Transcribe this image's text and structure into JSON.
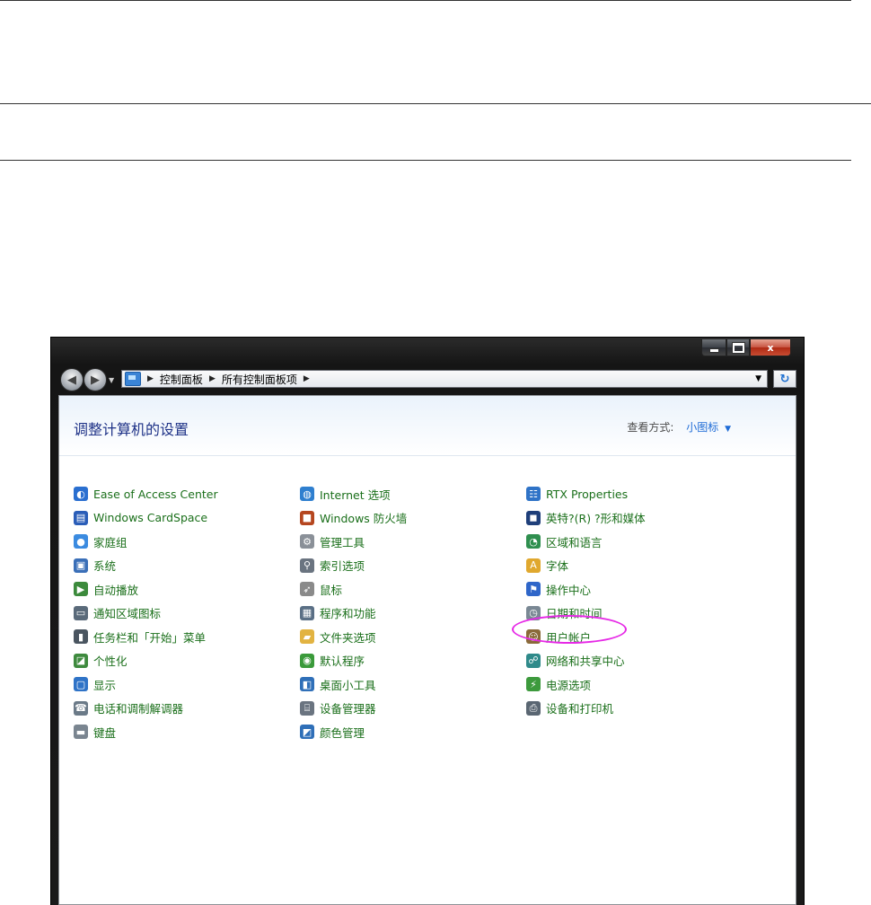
{
  "window": {
    "caption_buttons": {
      "minimize": "",
      "maximize": "",
      "close": "x"
    }
  },
  "address_bar": {
    "breadcrumbs": [
      "控制面板",
      "所有控制面板项"
    ]
  },
  "header": {
    "title": "调整计算机的设置",
    "view_by_label": "查看方式:",
    "view_by_value": "小图标"
  },
  "items": {
    "col1": [
      {
        "label": "Ease of Access Center",
        "icon": "ease-of-access-icon"
      },
      {
        "label": "Windows CardSpace",
        "icon": "cardspace-icon"
      },
      {
        "label": "家庭组",
        "icon": "homegroup-icon"
      },
      {
        "label": "系统",
        "icon": "system-icon"
      },
      {
        "label": "自动播放",
        "icon": "autoplay-icon"
      },
      {
        "label": "通知区域图标",
        "icon": "notification-icon"
      },
      {
        "label": "任务栏和「开始」菜单",
        "icon": "taskbar-icon"
      },
      {
        "label": "个性化",
        "icon": "personalization-icon"
      },
      {
        "label": "显示",
        "icon": "display-icon"
      },
      {
        "label": "电话和调制解调器",
        "icon": "phone-modem-icon"
      },
      {
        "label": "键盘",
        "icon": "keyboard-icon"
      }
    ],
    "col2": [
      {
        "label": "Internet 选项",
        "icon": "internet-options-icon"
      },
      {
        "label": "Windows 防火墙",
        "icon": "firewall-icon"
      },
      {
        "label": "管理工具",
        "icon": "admin-tools-icon"
      },
      {
        "label": "索引选项",
        "icon": "indexing-icon"
      },
      {
        "label": "鼠标",
        "icon": "mouse-icon"
      },
      {
        "label": "程序和功能",
        "icon": "programs-icon"
      },
      {
        "label": "文件夹选项",
        "icon": "folder-options-icon"
      },
      {
        "label": "默认程序",
        "icon": "default-programs-icon"
      },
      {
        "label": "桌面小工具",
        "icon": "gadgets-icon"
      },
      {
        "label": "设备管理器",
        "icon": "device-manager-icon"
      },
      {
        "label": "颜色管理",
        "icon": "color-management-icon"
      }
    ],
    "col3": [
      {
        "label": "RTX Properties",
        "icon": "rtx-icon"
      },
      {
        "label": "英特?(R) ?形和媒体",
        "icon": "intel-graphics-icon"
      },
      {
        "label": "区域和语言",
        "icon": "region-language-icon"
      },
      {
        "label": "字体",
        "icon": "fonts-icon"
      },
      {
        "label": "操作中心",
        "icon": "action-center-icon"
      },
      {
        "label": "日期和时间",
        "icon": "date-time-icon"
      },
      {
        "label": "用户帐户",
        "icon": "user-accounts-icon"
      },
      {
        "label": "网络和共享中心",
        "icon": "network-icon"
      },
      {
        "label": "电源选项",
        "icon": "power-icon"
      },
      {
        "label": "设备和打印机",
        "icon": "printers-icon"
      }
    ]
  },
  "colors": {
    "title": "#1e3287",
    "item_text": "#1a6f1a",
    "link": "#1e6bd6",
    "highlight": "#e629e6"
  }
}
